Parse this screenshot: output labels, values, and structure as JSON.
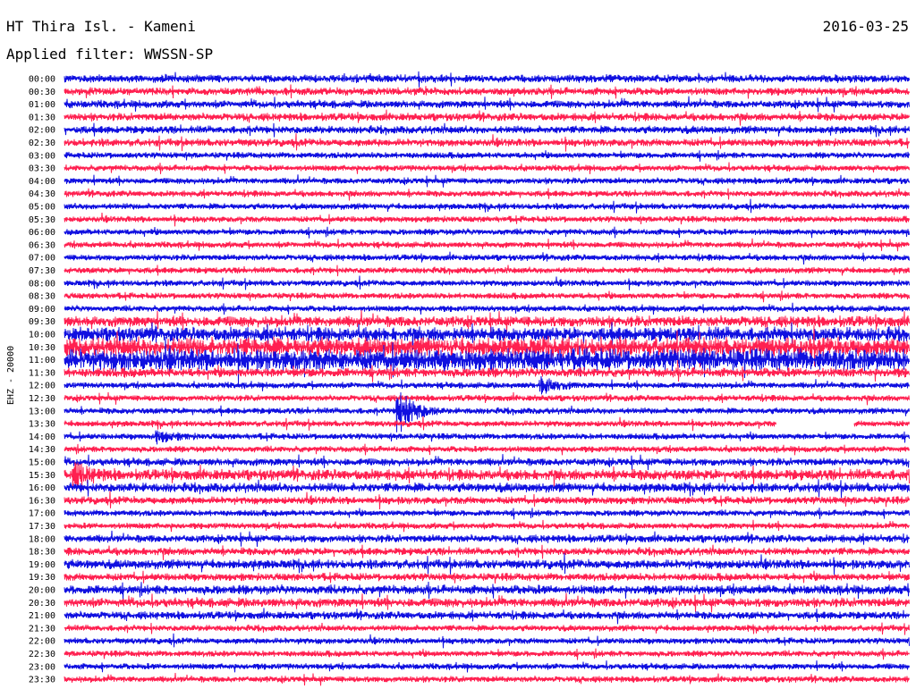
{
  "header": {
    "station": "HT Thira Isl. - Kameni",
    "date": "2016-03-25",
    "filter": "Applied filter: WWSSN-SP"
  },
  "chart_data": {
    "type": "line",
    "title": "HT Thira Isl. - Kameni",
    "subtitle": "Applied filter: WWSSN-SP",
    "ylabel": "EHZ - 20000",
    "tick_labels": [
      "00:00",
      "00:30",
      "01:00",
      "01:30",
      "02:00",
      "02:30",
      "03:00",
      "03:30",
      "04:00",
      "04:30",
      "05:00",
      "05:30",
      "06:00",
      "06:30",
      "07:00",
      "07:30",
      "08:00",
      "08:30",
      "09:00",
      "09:30",
      "10:00",
      "10:30",
      "11:00",
      "11:30",
      "12:00",
      "12:30",
      "13:00",
      "13:30",
      "14:00",
      "14:30",
      "15:00",
      "15:30",
      "16:00",
      "16:30",
      "17:00",
      "17:30",
      "18:00",
      "18:30",
      "19:00",
      "19:30",
      "20:00",
      "20:30",
      "21:00",
      "21:30",
      "22:00",
      "22:30",
      "23:00",
      "23:30"
    ],
    "trace_colors": [
      "#1010e0",
      "#ff2050"
    ],
    "noise_amplitude": [
      5,
      5,
      5,
      5,
      5,
      5,
      4,
      4,
      4,
      4,
      4,
      4,
      4,
      4,
      4,
      4,
      4,
      4,
      4,
      7,
      9,
      12,
      14,
      6,
      4,
      4,
      4,
      4,
      4,
      4,
      5,
      7,
      6,
      5,
      4,
      4,
      5,
      5,
      6,
      5,
      6,
      6,
      5,
      4,
      4,
      4,
      4,
      4
    ],
    "events": [
      {
        "row": 24,
        "x_fraction": 0.565,
        "amplitude": 9
      },
      {
        "row": 26,
        "x_fraction": 0.395,
        "amplitude": 26
      },
      {
        "row": 28,
        "x_fraction": 0.11,
        "amplitude": 6
      },
      {
        "row": 31,
        "x_fraction": 0.01,
        "amplitude": 12
      }
    ],
    "gaps": [
      {
        "row": 27,
        "start_fraction": 0.843,
        "end_fraction": 0.935
      }
    ],
    "grid": false,
    "legend": "none"
  }
}
